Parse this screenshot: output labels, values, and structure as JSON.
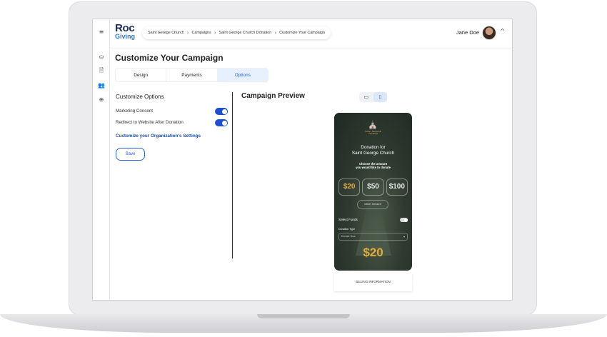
{
  "app": {
    "logo_title": "Roc",
    "logo_subtitle": "Giving"
  },
  "sidebar": {
    "items": [
      {
        "icon": "menu-icon",
        "glyph": "≡"
      },
      {
        "icon": "hands-icon",
        "glyph": "⛀"
      },
      {
        "icon": "document-icon",
        "glyph": "🗎"
      },
      {
        "icon": "people-icon",
        "glyph": "👥"
      },
      {
        "icon": "globe-icon",
        "glyph": "⊕"
      }
    ]
  },
  "breadcrumb": {
    "items": [
      "Saint George Church",
      "Campaigns",
      "Saint George Church Donation",
      "Customize Your Campaign"
    ],
    "separator": "›"
  },
  "user": {
    "name": "Jane Doe",
    "chevron": "^"
  },
  "page": {
    "title": "Customize Your Campaign"
  },
  "tabs": [
    {
      "label": "Design",
      "active": false
    },
    {
      "label": "Payments",
      "active": false
    },
    {
      "label": "Options",
      "active": true
    }
  ],
  "options": {
    "title": "Customize Options",
    "marketing_consent": {
      "label": "Marketing Consent",
      "enabled": true
    },
    "redirect": {
      "label": "Redirect to Website After Donation",
      "enabled": true
    },
    "org_settings_link": "Customize your Organization's Settings",
    "save_label": "Save"
  },
  "preview": {
    "title": "Campaign Preview",
    "device_desktop_glyph": "▭",
    "device_mobile_glyph": "▯",
    "selected_device": "mobile"
  },
  "phone": {
    "logo_glyph": "⛪",
    "church_label_line1": "SAINT GEORGE",
    "church_label_line2": "CHURCH",
    "heading_line1": "Donation for",
    "heading_line2": "Saint George Church",
    "sub_line1": "Choose the amount",
    "sub_line2": "you would like to donate",
    "amounts": [
      "$20",
      "$50",
      "$100"
    ],
    "selected_amount": "$20",
    "other_amount": "Other Amount",
    "select_funds": "Select Funds",
    "select_funds_enabled": false,
    "donation_type_label": "Donation Type",
    "donation_type_value": "Donate Now",
    "total": "$20",
    "accent_color": "#e6aa3b"
  },
  "billing": {
    "label": "BILLING INFORMATION"
  },
  "colors": {
    "primary": "#2f62d8",
    "brand_navy": "#1b2a57",
    "toggle_on": "#1f4fd1"
  }
}
